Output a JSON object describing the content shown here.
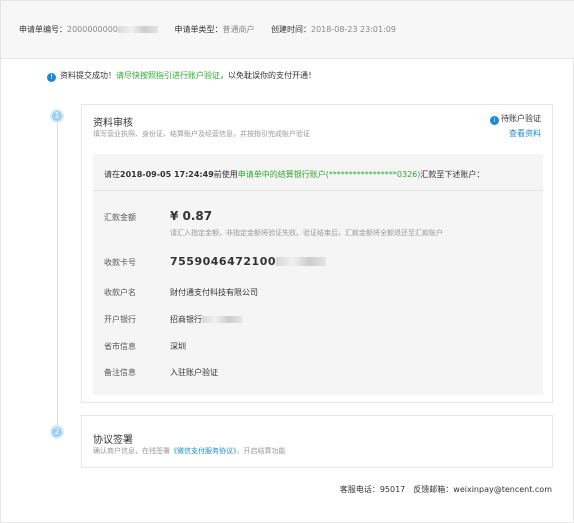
{
  "header": {
    "app_no_label": "申请单编号：",
    "app_no_value": "2000000000",
    "type_label": "申请单类型：",
    "type_value": "普通商户",
    "created_label": "创建时间：",
    "created_value": "2018-08-23 23:01:09"
  },
  "notice": {
    "icon": "!",
    "text_a": "资料提交成功！",
    "text_b": "请尽快按照指引进行账户验证",
    "text_c": "，以免耽误你的支付开通！"
  },
  "step1": {
    "number": "1",
    "title": "资料审核",
    "desc": "填写营业执照、身份证、结算账户及经营信息，并按指引完成账户验证",
    "status_icon": "i",
    "status": "待账户验证",
    "view_link": "查看资料",
    "instruction": {
      "prefix": "请在",
      "date": "2018-09-05 17:24:49",
      "mid": "前使用",
      "green": "申请单中的结算银行账户(*****************0326)",
      "suffix": "汇款至下述账户："
    },
    "rows": {
      "amount_label": "汇款金额",
      "amount_value": "¥ 0.87",
      "amount_note": "请汇入指定金额，非指定金额将验证失败。验证结束后，汇款金额将全额退还至汇款账户",
      "card_label": "收款卡号",
      "card_value": "7559046472100",
      "payee_label": "收款户名",
      "payee_value": "财付通支付科技有限公司",
      "bank_label": "开户银行",
      "bank_value": "招商银行",
      "city_label": "省市信息",
      "city_value": "深圳",
      "remark_label": "备注信息",
      "remark_value": "入驻账户验证"
    }
  },
  "step2": {
    "number": "2",
    "title": "协议签署",
    "desc_a": "确认商户信息，在线签署",
    "desc_link": "《微信支付服务协议》",
    "desc_b": "，开启结算功能"
  },
  "footer": {
    "phone": "客服电话：95017",
    "email": "反馈邮箱：weixinpay@tencent.com"
  },
  "colors": {
    "accent": "#1a8ad9",
    "green": "#2daa2d"
  }
}
